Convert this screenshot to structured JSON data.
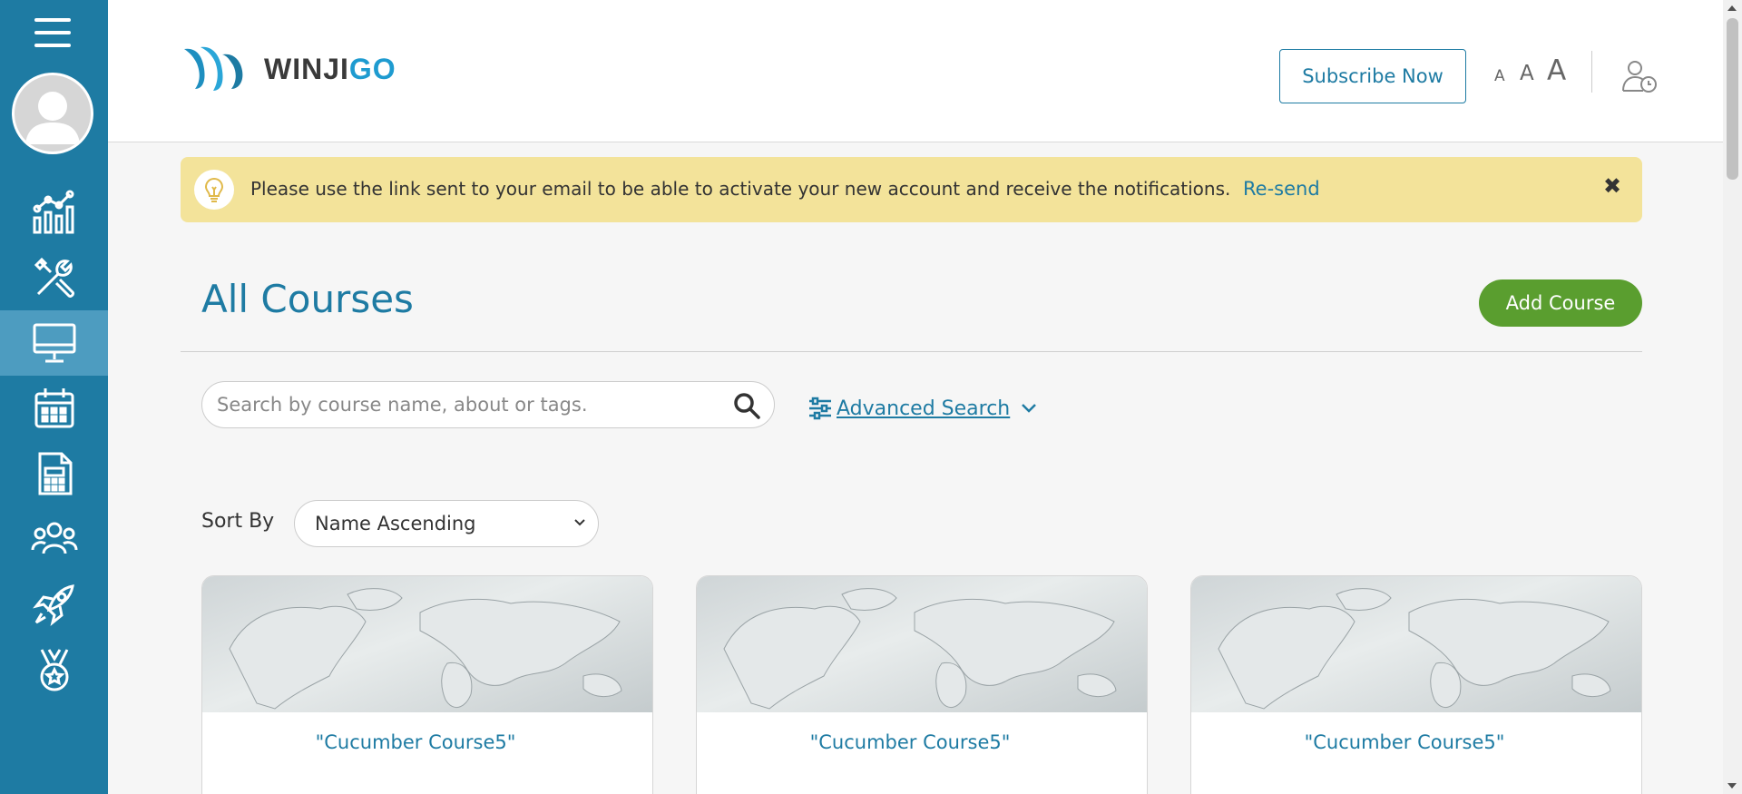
{
  "brand": {
    "logo_dark": "WINJI",
    "logo_light": "GO"
  },
  "header": {
    "subscribe_label": "Subscribe Now",
    "font_sizes": [
      "A",
      "A",
      "A"
    ]
  },
  "sidebar": {
    "items": [
      {
        "icon": "analytics-icon",
        "active": false
      },
      {
        "icon": "tools-icon",
        "active": false
      },
      {
        "icon": "courses-monitor-icon",
        "active": true
      },
      {
        "icon": "calendar-icon",
        "active": false
      },
      {
        "icon": "calculator-icon",
        "active": false
      },
      {
        "icon": "users-group-icon",
        "active": false
      },
      {
        "icon": "rocket-icon",
        "active": false
      },
      {
        "icon": "medal-icon",
        "active": false
      }
    ]
  },
  "alert": {
    "message": "Please use the link sent to your email to be able to activate your new account and receive the notifications.",
    "link": "Re-send",
    "close": "✖"
  },
  "page": {
    "title": "All Courses",
    "add_button": "Add Course"
  },
  "search": {
    "placeholder": "Search by course name, about or tags.",
    "value": "",
    "advanced_label": "Advanced Search"
  },
  "sort": {
    "label": "Sort By",
    "selected": "Name Ascending"
  },
  "courses": [
    {
      "title": "\"Cucumber Course5\""
    },
    {
      "title": "\"Cucumber Course5\""
    },
    {
      "title": "\"Cucumber Course5\""
    }
  ],
  "colors": {
    "sidebar": "#1e7ba3",
    "sidebar_active": "#4d9cc0",
    "accent": "#1e7ba3",
    "add_button": "#5a9e2f",
    "alert_bg": "#f3e39a"
  }
}
